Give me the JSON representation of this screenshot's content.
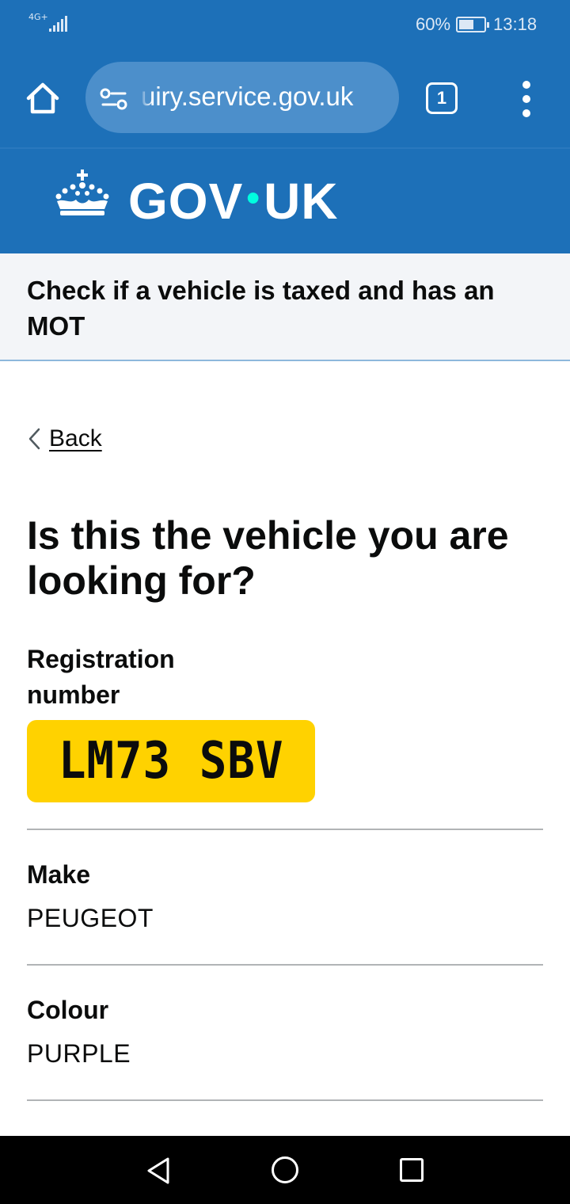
{
  "status_bar": {
    "network_type": "4G+",
    "battery_percent": "60%",
    "battery_level": 0.6,
    "time": "13:18"
  },
  "browser": {
    "url": "uiry.service.gov.uk",
    "tab_count": "1",
    "icons": [
      "home-icon",
      "site-settings-icon",
      "tabs-icon",
      "more-menu-icon"
    ]
  },
  "header": {
    "logotype_left": "GOV",
    "logotype_dot": "•",
    "logotype_right": "UK",
    "logo_icon": "crown-icon"
  },
  "service": {
    "name": "Check if a vehicle is taxed and has an MOT"
  },
  "back_link": {
    "label": "Back"
  },
  "main": {
    "heading": "Is this the vehicle you are looking for?"
  },
  "summary": {
    "registration": {
      "label": "Registration number",
      "value": "LM73 SBV"
    },
    "make": {
      "label": "Make",
      "value": "PEUGEOT"
    },
    "colour": {
      "label": "Colour",
      "value": "PURPLE"
    }
  },
  "nav_bar": {
    "icons": [
      "nav-back-icon",
      "nav-home-icon",
      "nav-recents-icon"
    ]
  },
  "colors": {
    "brand_blue": "#1d70b8",
    "plate_yellow": "#ffd200",
    "logo_dot": "#00ffe0",
    "text": "#0b0c0c"
  }
}
